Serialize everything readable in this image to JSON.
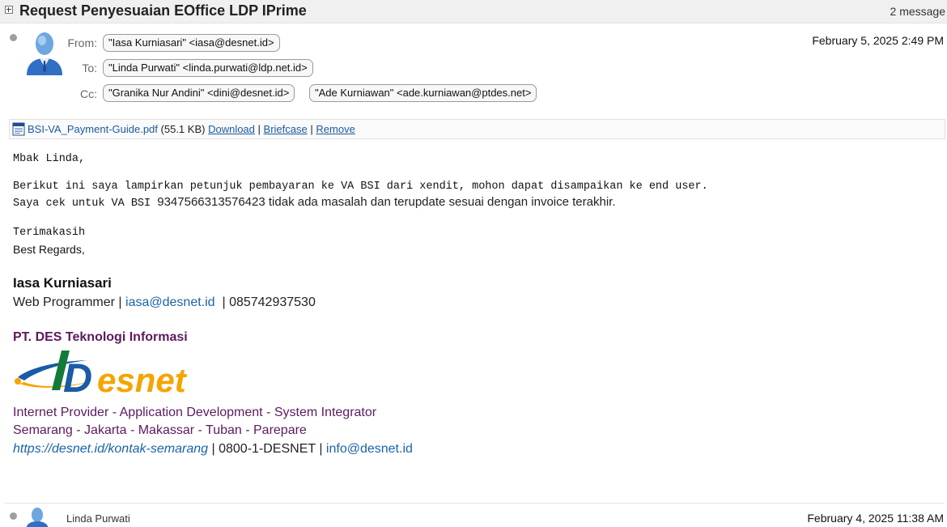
{
  "thread": {
    "subject": "Request Penyesuaian EOffice LDP IPrime",
    "message_count": "2 message"
  },
  "message1": {
    "from_label": "From:",
    "to_label": "To:",
    "cc_label": "Cc:",
    "from": "\"Iasa Kurniasari\" <iasa@desnet.id>",
    "to": "\"Linda Purwati\" <linda.purwati@ldp.net.id>",
    "cc": [
      "\"Granika Nur Andini\" <dini@desnet.id>",
      "\"Ade Kurniawan\" <ade.kurniawan@ptdes.net>"
    ],
    "date": "February 5, 2025 2:49 PM",
    "attachment": {
      "name": "BSI-VA_Payment-Guide.pdf",
      "size": "(55.1 KB)",
      "download": "Download",
      "briefcase": "Briefcase",
      "remove": "Remove",
      "sep": "|"
    },
    "body": {
      "greeting": "Mbak Linda,",
      "line1": "Berikut ini saya lampirkan petunjuk pembayaran ke VA BSI dari xendit, mohon dapat disampaikan ke end user.",
      "line2_mono": "Saya cek untuk VA BSI ",
      "line2_sans": "9347566313576423 tidak ada masalah dan terupdate sesuai dengan invoice terakhir.",
      "thanks": "Terimakasih",
      "regards": "Best Regards,"
    },
    "signature": {
      "name": "Iasa Kurniasari",
      "role": "Web Programmer",
      "email": "iasa@desnet.id",
      "phone": "085742937530",
      "company": "PT. DES Teknologi Informasi",
      "logo_text": "Desnet",
      "services": "Internet Provider - Application Development - System Integrator",
      "cities": "Semarang - Jakarta - Makassar - Tuban - Parepare",
      "url": "https://desnet.id/kontak-semarang",
      "hotline": "0800-1-DESNET",
      "info_email": "info@desnet.id",
      "sep": "|"
    }
  },
  "message2": {
    "from_name": "Linda Purwati",
    "date": "February 4, 2025 11:38 AM"
  },
  "colors": {
    "link": "#1a63a8",
    "signature_purple": "#5c1a5c",
    "logo_blue": "#1b5aa6",
    "logo_orange": "#f5a400"
  }
}
